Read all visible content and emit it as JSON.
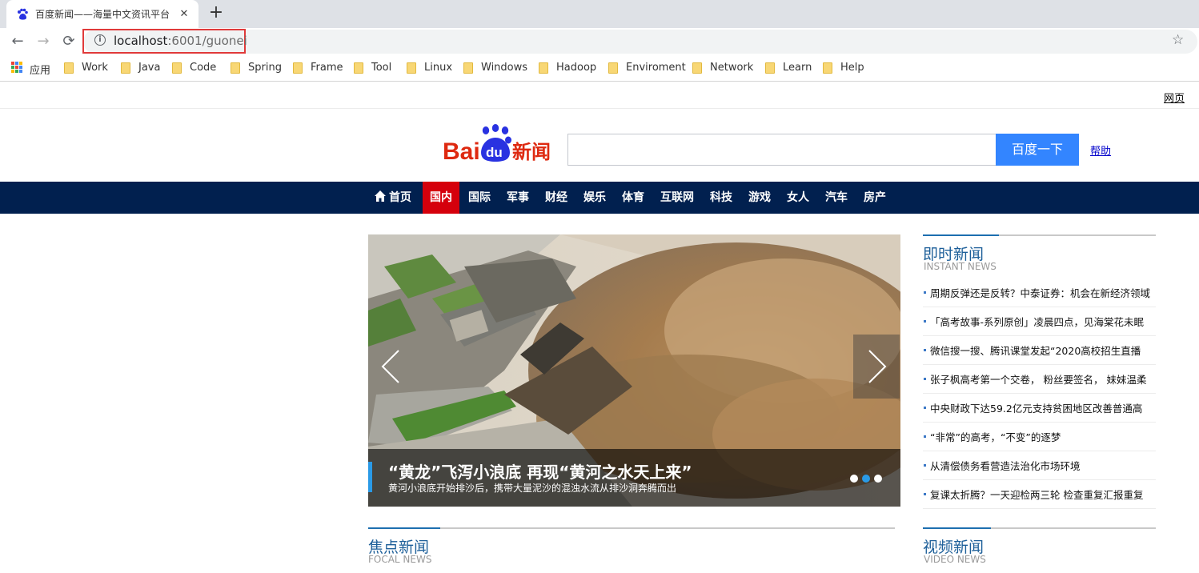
{
  "browser": {
    "tab_title": "百度新闻——海量中文资讯平台",
    "tab_close": "✕",
    "new_tab": "+",
    "url_host": "localhost",
    "url_rest": ":6001/guonei",
    "back": "←",
    "forward": "→",
    "reload": "⟳",
    "star": "☆"
  },
  "bookmarks": {
    "apps_label": "应用",
    "items": [
      "Work",
      "Java",
      "Code",
      "Spring",
      "Frame",
      "Tool",
      "Linux",
      "Windows",
      "Hadoop",
      "Enviroment",
      "Network",
      "Learn",
      "Help"
    ]
  },
  "header": {
    "webpage_link": "网页",
    "logo_bai": "Bai",
    "logo_du": "du",
    "logo_news": "新闻",
    "search_value": "",
    "search_button": "百度一下",
    "help_link": "帮助"
  },
  "nav": {
    "items": [
      "首页",
      "国内",
      "国际",
      "军事",
      "财经",
      "娱乐",
      "体育",
      "互联网",
      "科技",
      "游戏",
      "女人",
      "汽车",
      "房产"
    ],
    "active": "国内"
  },
  "slider": {
    "title": "“黄龙”飞泻小浪底  再现“黄河之水天上来”",
    "subtitle": "黄河小浪底开始排沙后，携带大量泥沙的混浊水流从排沙洞奔腾而出",
    "active_dot": 2,
    "dot_count": 3
  },
  "instant_news": {
    "title": "即时新闻",
    "en": "INSTANT NEWS",
    "items": [
      "周期反弹还是反转？中泰证券：机会在新经济领域",
      "「高考故事-系列原创」凌晨四点，见海棠花未眠",
      "微信搜一搜、腾讯课堂发起“2020高校招生直播",
      "张子枫高考第一个交卷， 粉丝要签名， 妹妹温柔",
      "中央财政下达59.2亿元支持贫困地区改善普通高",
      "“非常”的高考，“不变”的逐梦",
      "从清偿债务看营造法治化市场环境",
      "复课太折腾？一天迎检两三轮 检查重复汇报重复"
    ]
  },
  "focal_news": {
    "title": "焦点新闻",
    "en": "FOCAL NEWS"
  },
  "video_news": {
    "title": "视频新闻",
    "en": "VIDEO NEWS"
  },
  "colors": {
    "nav_bg": "#01204f",
    "nav_active": "#d5000c",
    "search_button": "#3385ff",
    "section_title": "#1d5f99",
    "url_highlight": "#e03a3a"
  }
}
